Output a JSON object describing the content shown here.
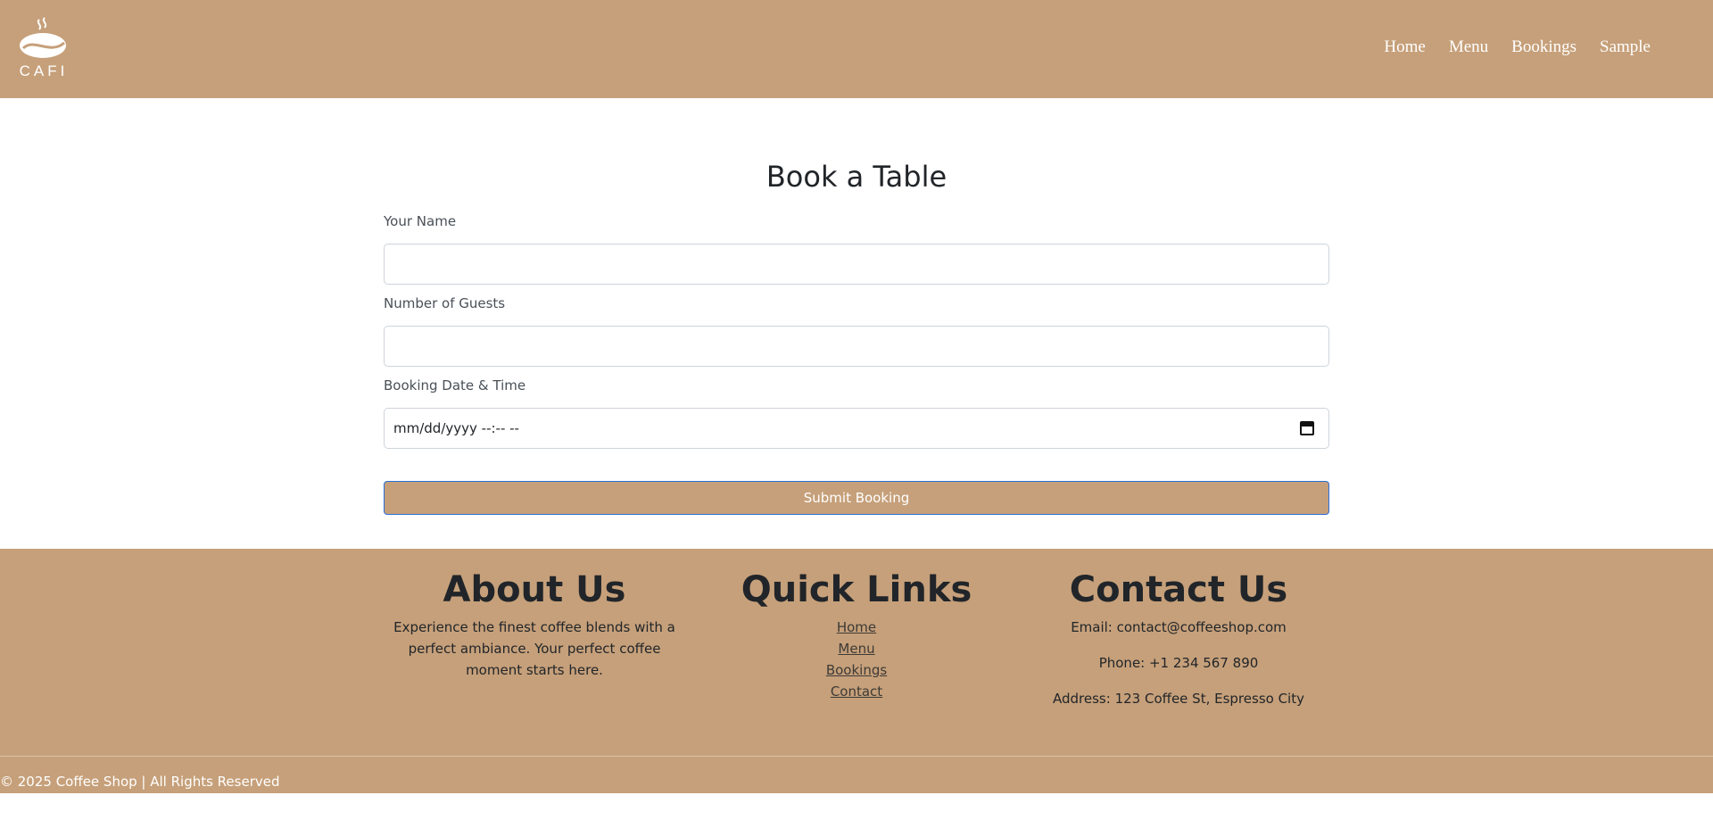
{
  "brand": {
    "logo_text": "CAFI"
  },
  "nav": {
    "links": [
      "Home",
      "Menu",
      "Bookings",
      "Sample"
    ]
  },
  "booking": {
    "title": "Book a Table",
    "name_label": "Your Name",
    "name_value": "",
    "guests_label": "Number of Guests",
    "guests_value": "",
    "datetime_label": "Booking Date & Time",
    "datetime_value": "mm/dd/yyyy --:-- --",
    "submit_label": "Submit Booking"
  },
  "footer": {
    "about": {
      "title": "About Us",
      "text": "Experience the finest coffee blends with a perfect ambiance. Your perfect coffee moment starts here."
    },
    "quick_links": {
      "title": "Quick Links",
      "links": [
        "Home",
        "Menu",
        "Bookings",
        "Contact"
      ]
    },
    "contact": {
      "title": "Contact Us",
      "email": "Email: contact@coffeeshop.com",
      "phone": "Phone: +1 234 567 890",
      "address": "Address: 123 Coffee St, Espresso City"
    },
    "copyright": "© 2025 Coffee Shop | All Rights Reserved"
  },
  "colors": {
    "brand_tan": "#c6a07a",
    "text_dark": "#212529",
    "button_border": "#2a6fd6"
  }
}
